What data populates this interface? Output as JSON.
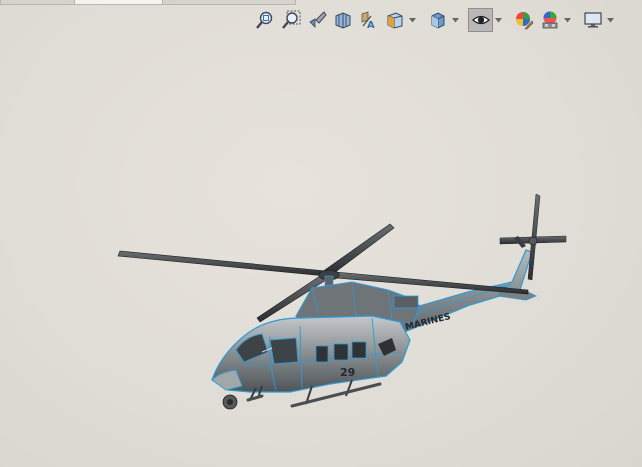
{
  "window": {
    "background": "#e0ddd6"
  },
  "tabs": [
    {
      "label": "",
      "active": false
    },
    {
      "label": "",
      "active": true
    },
    {
      "label": "",
      "active": false
    }
  ],
  "heads_up_toolbar": {
    "tools": [
      {
        "icon": "zoom-to-fit-icon"
      },
      {
        "icon": "zoom-to-area-icon"
      },
      {
        "icon": "previous-view-icon"
      },
      {
        "icon": "section-view-icon"
      },
      {
        "icon": "dynamic-annotation-views-icon"
      },
      {
        "icon": "view-orientation-icon",
        "has_dropdown": true
      },
      {
        "icon": "display-style-icon",
        "has_dropdown": true
      },
      {
        "icon": "hide-show-items-icon",
        "has_dropdown": true,
        "active": true
      },
      {
        "icon": "edit-appearance-icon"
      },
      {
        "icon": "apply-scene-icon",
        "has_dropdown": true
      },
      {
        "icon": "view-settings-icon",
        "has_dropdown": true
      }
    ]
  },
  "model": {
    "name": "helicopter",
    "body_color": "#8e9396",
    "edge_color": "#2e9bd6",
    "tail_text": "MARINES",
    "side_text": "29"
  }
}
